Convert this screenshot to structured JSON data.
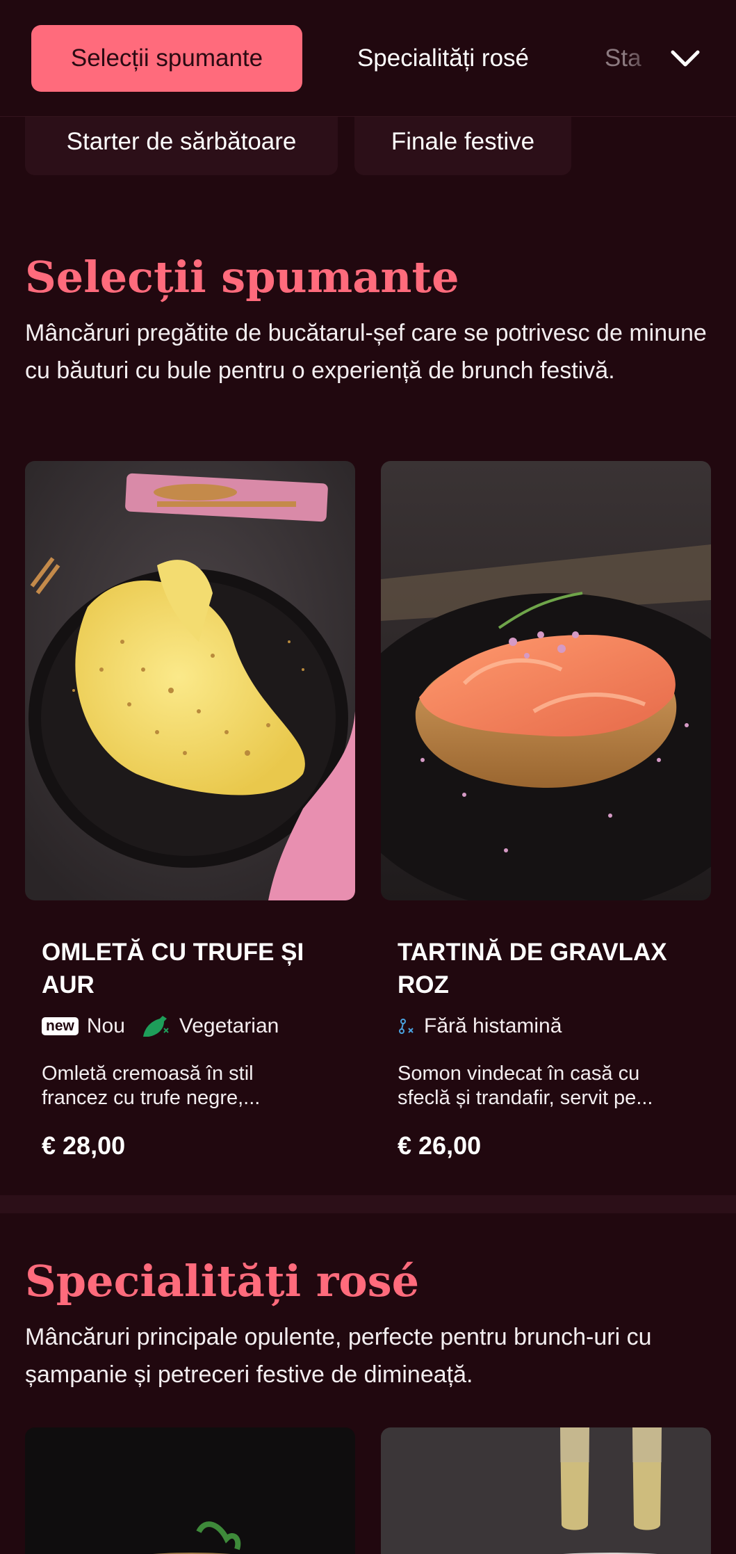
{
  "nav": {
    "tabs": [
      {
        "label": "Selecții spumante",
        "active": true
      },
      {
        "label": "Specialități rosé",
        "active": false
      },
      {
        "label": "Sta",
        "active": false
      }
    ],
    "chips": [
      "Starter de sărbătoare",
      "Finale festive"
    ],
    "expand_icon": "chevron-down-icon"
  },
  "sections": [
    {
      "title": "Selecții spumante",
      "description": "Mâncăruri pregătite de bucătarul-șef care se potrivesc de minune cu băuturi cu bule pentru o experiență de brunch festivă.",
      "items": [
        {
          "title_line1": "OMLETĂ CU TRUFE ȘI",
          "title_line2": "AUR",
          "badge": "new",
          "tag1": "Nou",
          "tag2": "Vegetarian",
          "desc_line1": "Omletă cremoasă în stil",
          "desc_line2": "francez cu trufe negre,...",
          "price": "€ 28,00"
        },
        {
          "title_line1": "TARTINĂ DE GRAVLAX",
          "title_line2": "ROZ",
          "tag1": "Fără histamină",
          "desc_line1": "Somon vindecat în casă cu",
          "desc_line2": "sfeclă și trandafir, servit pe...",
          "price": "€ 26,00"
        }
      ]
    },
    {
      "title": "Specialități rosé",
      "description": "Mâncăruri principale opulente, perfecte pentru brunch-uri cu șampanie și petreceri festive de dimineață."
    }
  ],
  "colors": {
    "background": "#21080f",
    "accent": "#ff6b7c",
    "chip_bg": "#2c0f18",
    "vegetarian_icon": "#1e9e5a",
    "histamine_icon": "#4ba3e0"
  }
}
